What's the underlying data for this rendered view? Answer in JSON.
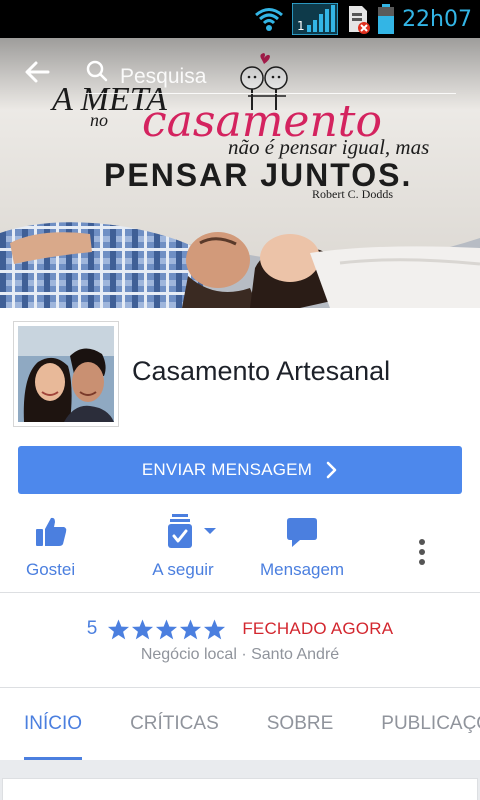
{
  "status_bar": {
    "time": "22h07",
    "network_badge": "1",
    "icons": [
      "wifi-icon",
      "signal-icon",
      "sim-error-icon",
      "battery-icon"
    ]
  },
  "header": {
    "search_placeholder": "Pesquisa"
  },
  "cover": {
    "line1": "A META",
    "line2": "no",
    "line3": "casamento",
    "line4": "não é pensar igual, mas",
    "line5": "PENSAR JUNTOS.",
    "author": "Robert C. Dodds"
  },
  "page": {
    "name": "Casamento Artesanal"
  },
  "message_button": {
    "label": "ENVIAR MENSAGEM"
  },
  "actions": [
    {
      "label": "Gostei",
      "icon": "thumbs-up-icon"
    },
    {
      "label": "A seguir",
      "icon": "following-icon"
    },
    {
      "label": "Mensagem",
      "icon": "message-bubble-icon"
    }
  ],
  "rating": {
    "value": "5",
    "stars": 5,
    "status": "FECHADO AGORA"
  },
  "category_line": "Negócio local · Santo André",
  "tabs": [
    {
      "label": "INÍCIO",
      "active": true
    },
    {
      "label": "CRÍTICAS",
      "active": false
    },
    {
      "label": "SOBRE",
      "active": false
    },
    {
      "label": "PUBLICAÇÕES",
      "active": false
    }
  ],
  "colors": {
    "accent": "#4b7fdf",
    "button": "#4d88ec",
    "closed": "#d3272f",
    "status_accent": "#33b5e5"
  }
}
